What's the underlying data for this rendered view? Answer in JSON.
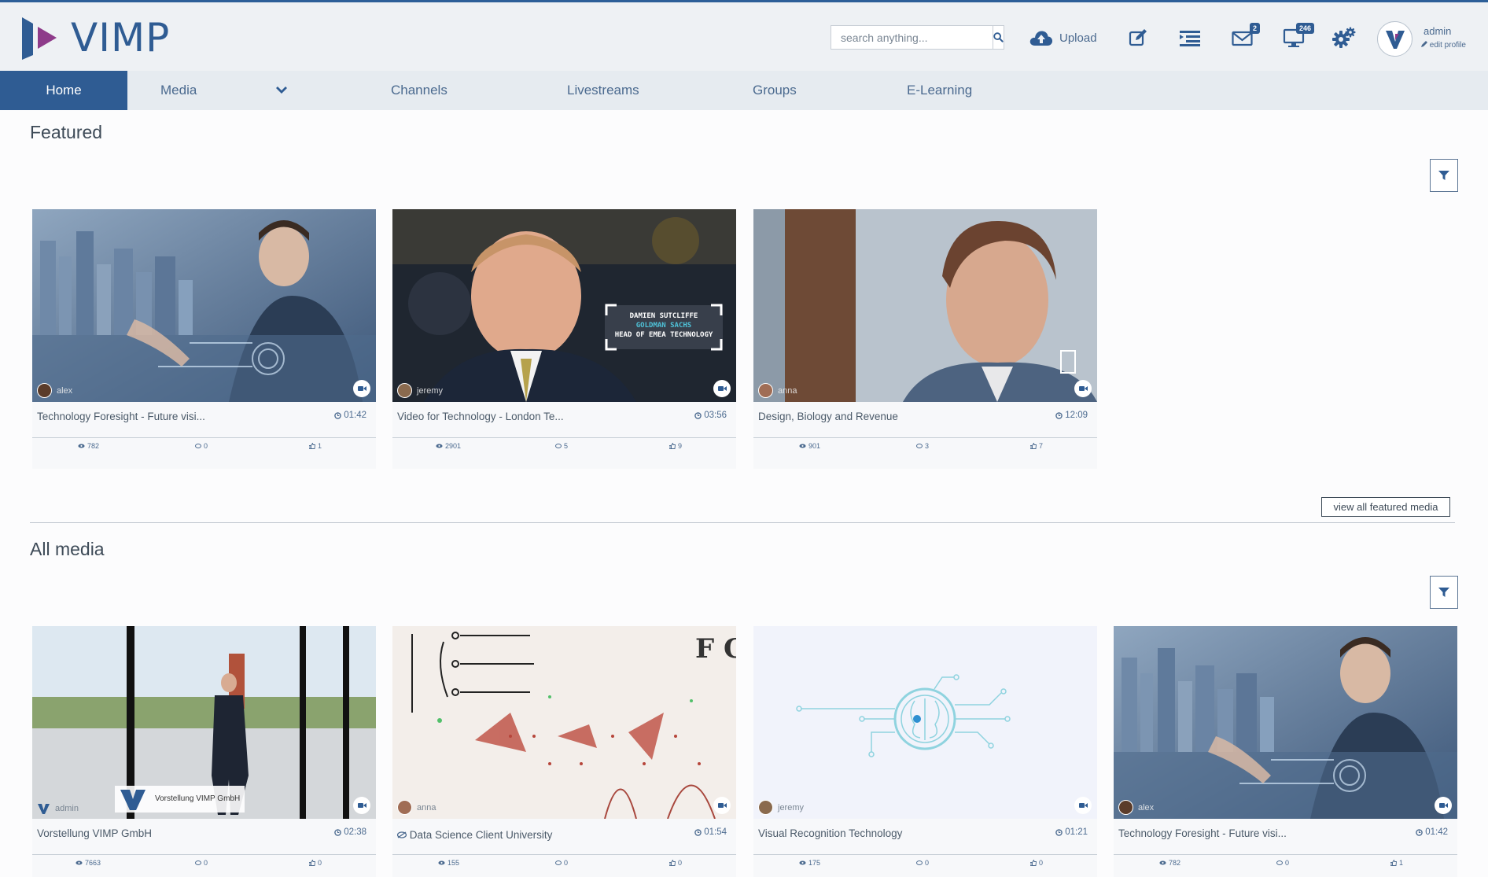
{
  "app": {
    "name": "VIMP"
  },
  "search": {
    "placeholder": "search anything..."
  },
  "toolbar": {
    "upload_label": "Upload",
    "messages_badge": "2",
    "notifications_badge": "246"
  },
  "profile": {
    "name": "admin",
    "edit_label": "edit profile"
  },
  "nav": {
    "home": "Home",
    "media": "Media",
    "channels": "Channels",
    "livestreams": "Livestreams",
    "groups": "Groups",
    "elearning": "E-Learning"
  },
  "featured": {
    "title": "Featured",
    "view_all": "view all featured media",
    "items": [
      {
        "title": "Technology Foresight - Future visi...",
        "duration": "01:42",
        "uploader": "alex",
        "views": "782",
        "comments": "0",
        "likes": "1"
      },
      {
        "title": "Video for Technology - London Te...",
        "duration": "03:56",
        "uploader": "jeremy",
        "views": "2901",
        "comments": "5",
        "likes": "9",
        "overlay": [
          "DAMIEN SUTCLIFFE",
          "GOLDMAN SACHS",
          "HEAD OF EMEA TECHNOLOGY"
        ]
      },
      {
        "title": "Design, Biology and Revenue",
        "duration": "12:09",
        "uploader": "anna",
        "views": "901",
        "comments": "3",
        "likes": "7"
      }
    ]
  },
  "all_media": {
    "title": "All media",
    "items": [
      {
        "title": "Vorstellung VIMP GmbH",
        "duration": "02:38",
        "uploader": "admin",
        "views": "7663",
        "comments": "0",
        "likes": "0",
        "overlay": "Vorstellung VIMP GmbH"
      },
      {
        "title": "Data Science Client University",
        "duration": "01:54",
        "uploader": "anna",
        "views": "155",
        "comments": "0",
        "likes": "0"
      },
      {
        "title": "Visual Recognition Technology",
        "duration": "01:21",
        "uploader": "jeremy",
        "views": "175",
        "comments": "0",
        "likes": "0"
      },
      {
        "title": "Technology Foresight - Future visi...",
        "duration": "01:42",
        "uploader": "alex",
        "views": "782",
        "comments": "0",
        "likes": "1"
      }
    ]
  },
  "colors": {
    "brand": "#2f5c93",
    "accent": "#8e3b8a",
    "nav_bg": "#e6ebf0",
    "topbar_bg": "#eef1f4"
  },
  "icons": [
    "search-icon",
    "upload-cloud-icon",
    "edit-icon",
    "list-icon",
    "mail-icon",
    "monitor-icon",
    "gears-icon",
    "chevron-down-icon",
    "filter-icon",
    "video-camera-icon",
    "clock-icon",
    "eye-icon",
    "comment-icon",
    "thumbs-up-icon",
    "pencil-icon"
  ]
}
